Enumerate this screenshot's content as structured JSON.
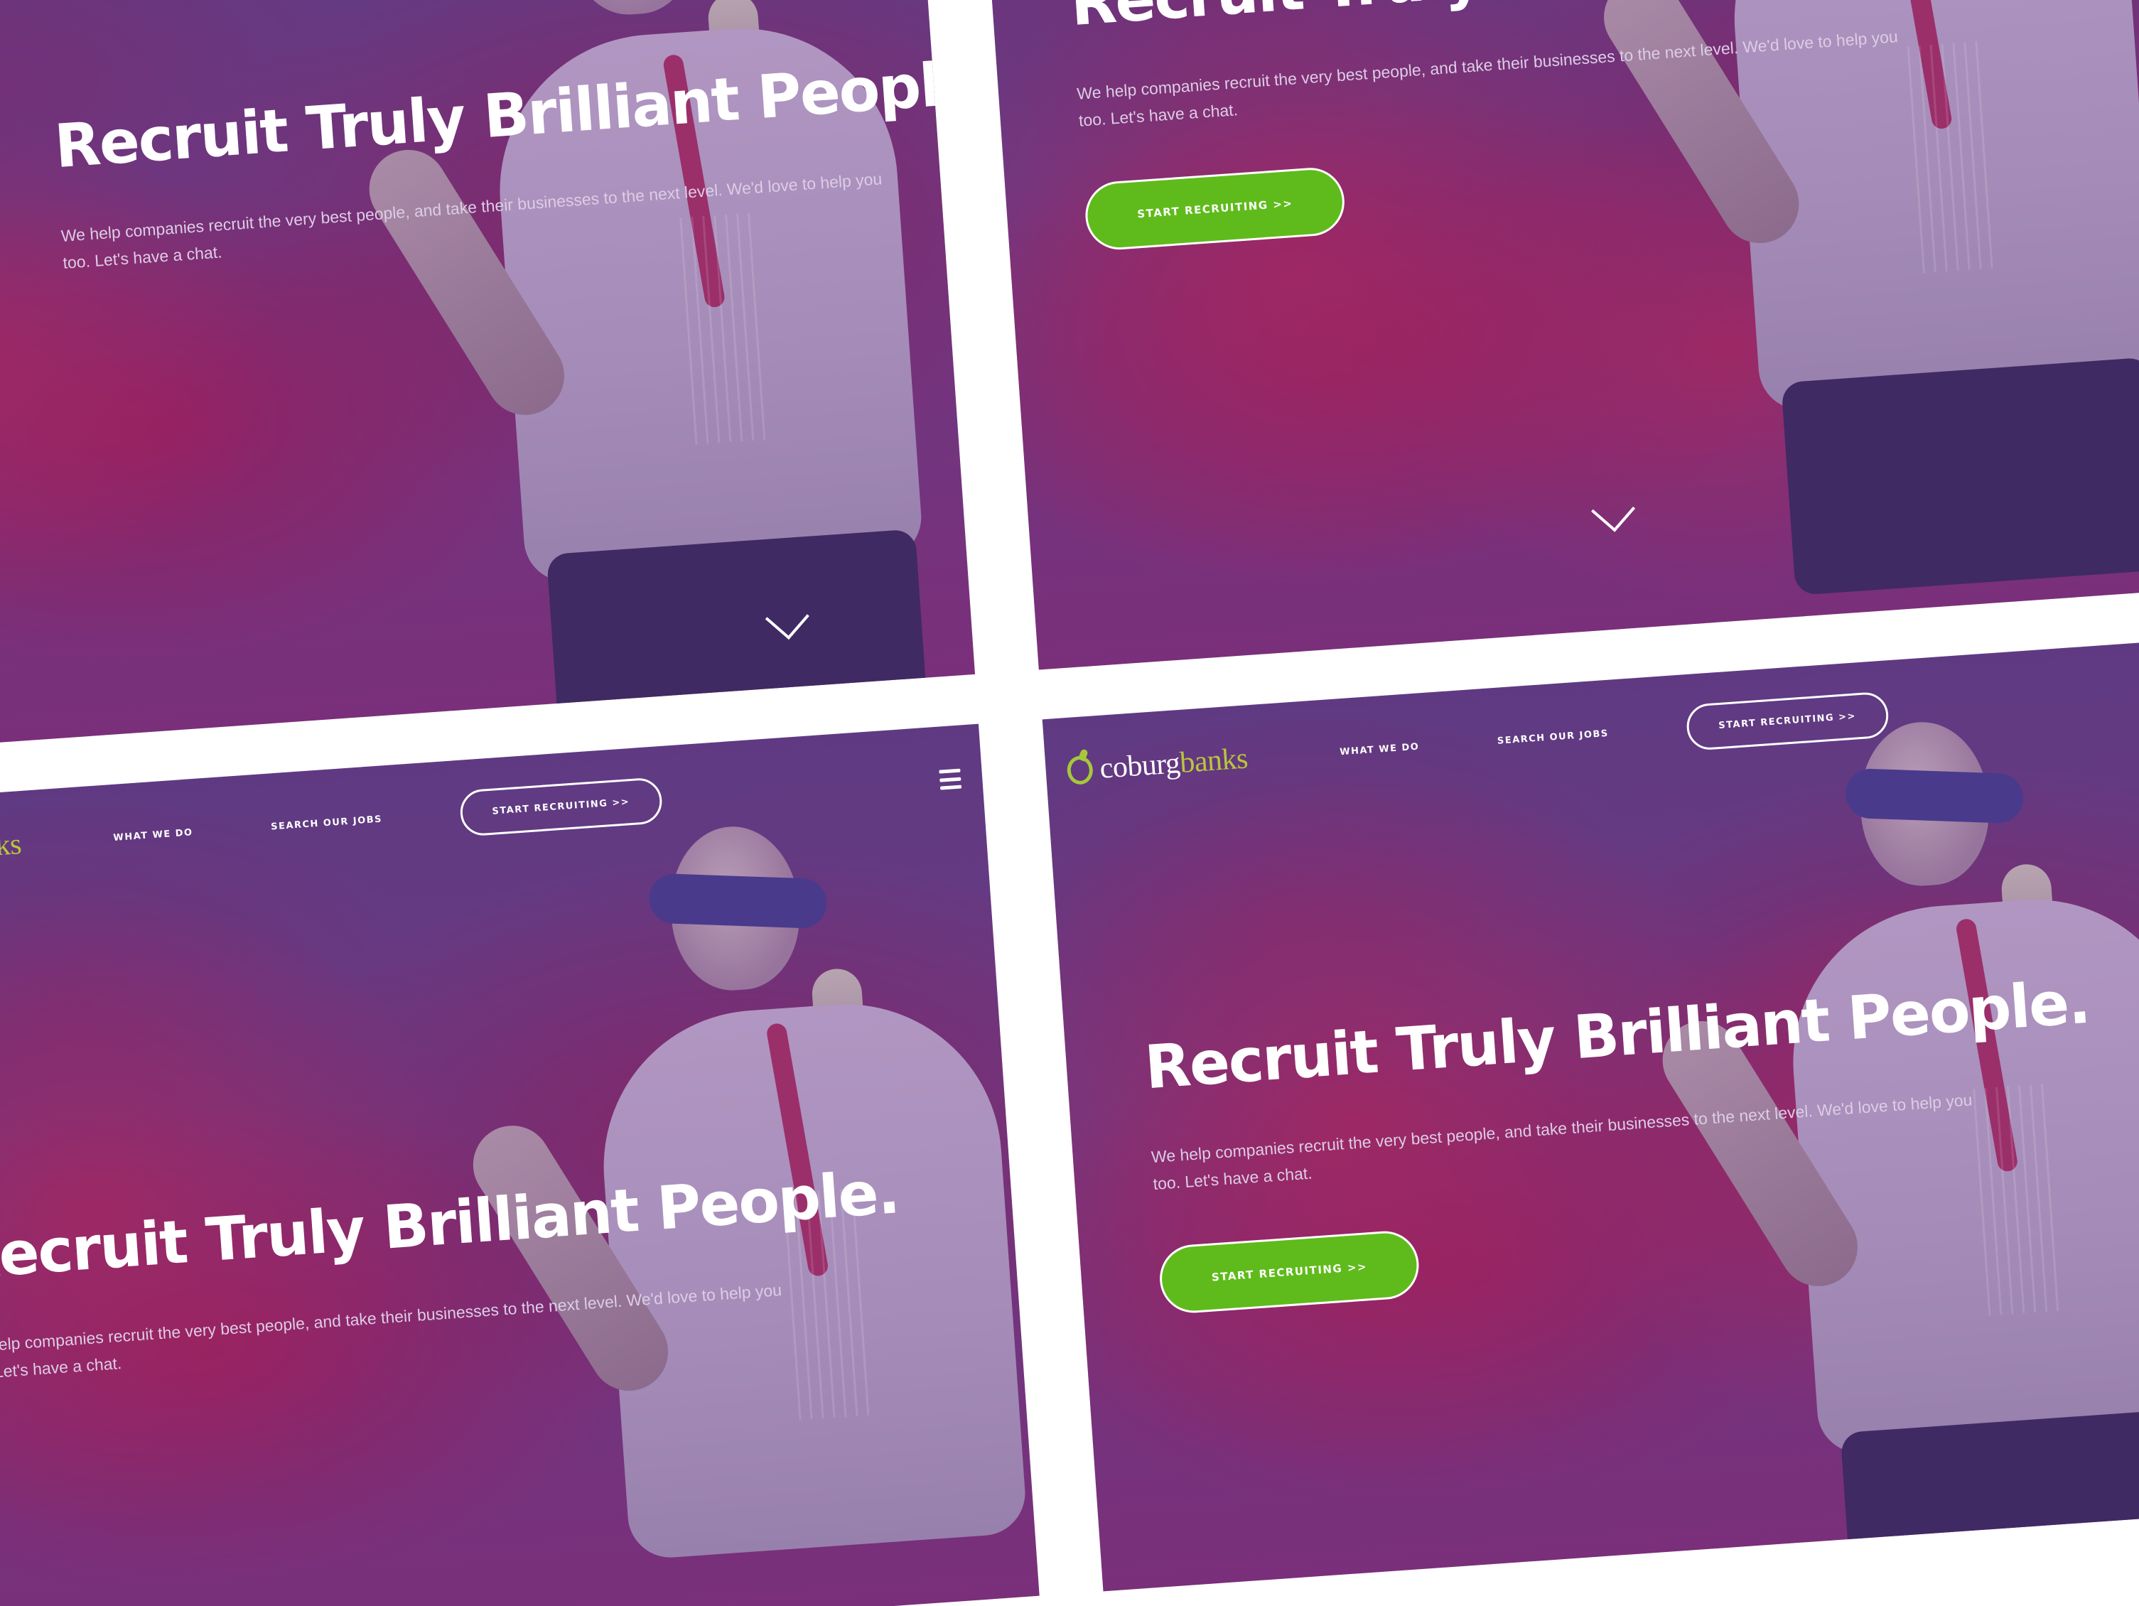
{
  "brand": {
    "word1": "coburg",
    "word2": "banks",
    "icon": "apple-icon",
    "colors": {
      "accent_green": "#5fbb1b",
      "logo_green": "#a6c83a",
      "overlay_purple": "#6a3a83",
      "white": "#ffffff"
    }
  },
  "nav": {
    "links": [
      "WHAT WE DO",
      "SEARCH OUR JOBS"
    ],
    "cta_label": "START RECRUITING >>",
    "menu_icon": "hamburger-icon"
  },
  "hero": {
    "title": "Recruit Truly Brilliant People.",
    "subtitle": "We help companies recruit the very best people, and take their businesses to the next level. We'd love to help you too. Let's have a chat.",
    "cta_label": "START RECRUITING >>",
    "scroll_icon": "chevron-down-icon"
  }
}
